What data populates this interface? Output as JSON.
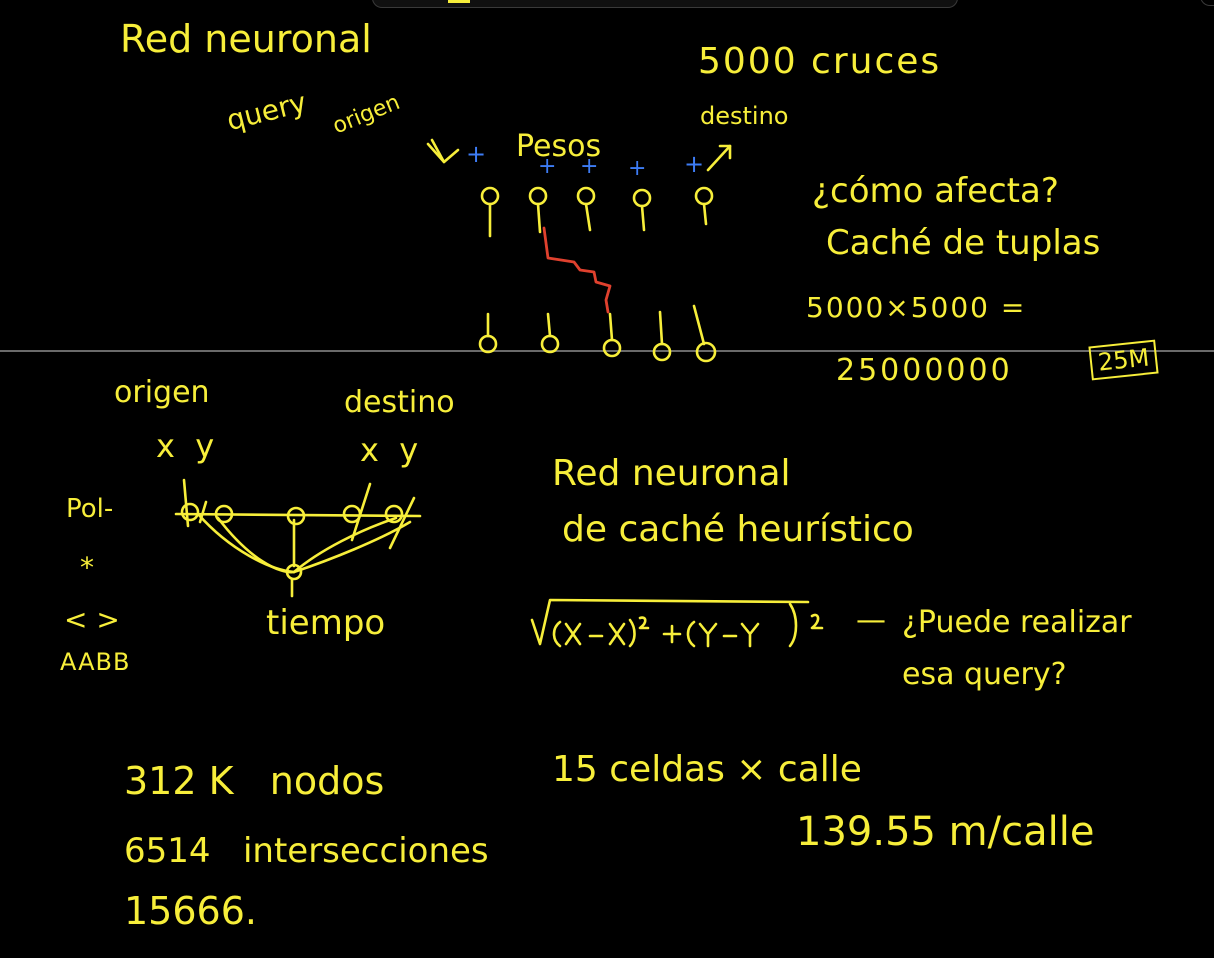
{
  "texts": {
    "title_red_neuronal": "Red neuronal",
    "cruces": "5000 cruces",
    "query": "query",
    "origen": "origen",
    "destino": "destino",
    "pesos": "Pesos",
    "como_afecta": "¿cómo afecta?",
    "cache_tuplas": "Caché de tuplas",
    "mult": "5000×5000 =",
    "result": "25000000",
    "result_box": "25M",
    "origen2": "origen",
    "destino2": "destino",
    "xy_left": "x  y",
    "xy_right": "x  y",
    "pol": "Pol-",
    "star": "*",
    "angle": "< >",
    "aabb": "AABB",
    "tiempo": "tiempo",
    "heur_line1": "Red neuronal",
    "heur_line2": "de caché heurístico",
    "formula_dash": "—",
    "puede_line1": "¿Puede realizar",
    "puede_line2": "esa query?",
    "nodos": "312 K   nodos",
    "intersecciones": "6514   intersecciones",
    "n15666": "15666.",
    "celdas": "15 celdas × calle",
    "m_calle": "139.55 m/calle"
  },
  "colors": {
    "ink": "#f7ee3a",
    "blue": "#3d7cf5",
    "red": "#e0412e",
    "background": "#000000",
    "divider": "#6a6a6a"
  },
  "icons": {
    "formula": "sqrt-formula-glyph",
    "network": "neural-network-sketch",
    "road": "road-crossing-sketch"
  }
}
